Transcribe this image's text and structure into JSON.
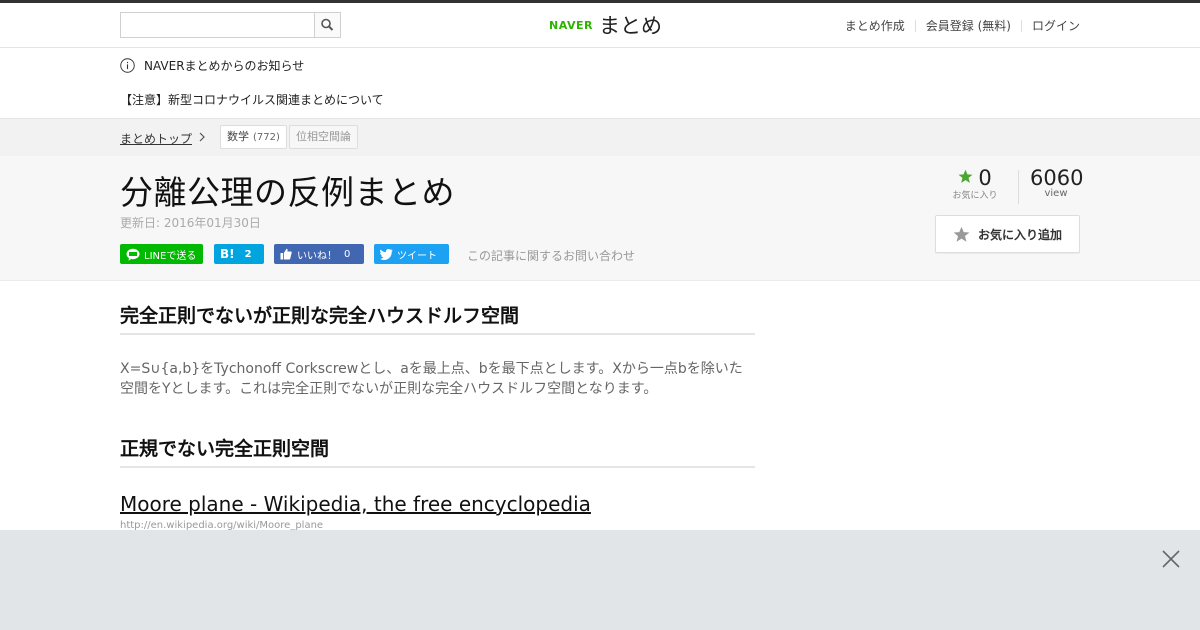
{
  "header": {
    "search_placeholder": "",
    "logo_naver": "NAVER",
    "logo_matome": "まとめ",
    "nav": [
      "まとめ作成",
      "会員登録 (無料)",
      "ログイン"
    ]
  },
  "notices": {
    "title": "NAVERまとめからのお知らせ",
    "link": "【注意】新型コロナウイルス関連まとめについて"
  },
  "breadcrumb": {
    "top": "まとめトップ",
    "tag1_label": "数学",
    "tag1_count": "(772)",
    "tag2_label": "位相空間論"
  },
  "article": {
    "title": "分離公理の反例まとめ",
    "updated": "更新日: 2016年01月30日",
    "share": {
      "line": "LINEで送る",
      "hatena_count": "2",
      "fb_like": "いいね！",
      "fb_count": "0",
      "tweet": "ツイート"
    },
    "contact": "この記事に関するお問い合わせ",
    "favorites_count": "0",
    "favorites_label": "お気に入り",
    "views_count": "6060",
    "views_label": "view",
    "fav_button": "お気に入り追加"
  },
  "content": {
    "heading1": "完全正則でないが正則な完全ハウスドルフ空間",
    "para1": "X=S∪{a,b}をTychonoff Corkscrewとし、aを最上点、bを最下点とします。Xから一点bを除いた空間をYとします。これは完全正則でないが正則な完全ハウスドルフ空間となります。",
    "heading2": "正規でない完全正則空間",
    "link_title": "Moore plane - Wikipedia, the free encyclopedia",
    "link_url": "http://en.wikipedia.org/wiki/Moore_plane"
  },
  "colors": {
    "naver_green": "#2db400",
    "line_green": "#00b900",
    "hatena_blue": "#00a4de",
    "facebook_blue": "#4267b2",
    "twitter_blue": "#1da1f2"
  }
}
